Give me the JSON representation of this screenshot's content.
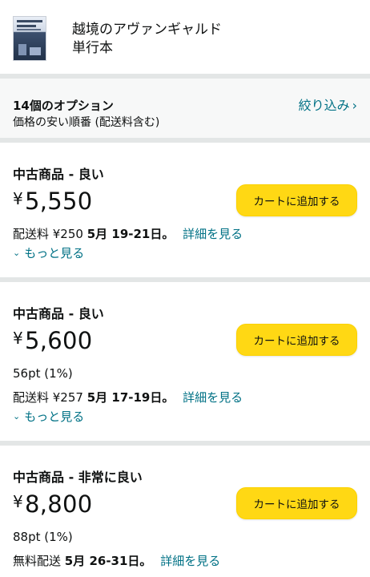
{
  "product": {
    "title": "越境のアヴァンギャルド",
    "format": "単行本"
  },
  "options_bar": {
    "count": "14個のオプション",
    "sort": "価格の安い順番 (配送料含む)",
    "filter_label": "絞り込み",
    "filter_chevron": "›"
  },
  "offers": [
    {
      "condition": "中古商品 - 良い",
      "currency": "¥",
      "price": "5,550",
      "points": "",
      "shipping_prefix": "配送料 ¥250",
      "delivery_date": "5月 19-21日。",
      "details_link": "詳細を見る",
      "more_link": "もっと見る",
      "cart_button": "カートに追加する"
    },
    {
      "condition": "中古商品 - 良い",
      "currency": "¥",
      "price": "5,600",
      "points": "56pt (1%)",
      "shipping_prefix": "配送料 ¥257",
      "delivery_date": "5月 17-19日。",
      "details_link": "詳細を見る",
      "more_link": "もっと見る",
      "cart_button": "カートに追加する"
    },
    {
      "condition": "中古商品 - 非常に良い",
      "currency": "¥",
      "price": "8,800",
      "points": "88pt (1%)",
      "shipping_prefix": "無料配送",
      "delivery_date": "5月 26-31日。",
      "details_link": "詳細を見る",
      "cart_button": "カートに追加する"
    }
  ],
  "colors": {
    "link": "#007185",
    "cart_button": "#ffd814",
    "divider": "#e3e6e6"
  }
}
